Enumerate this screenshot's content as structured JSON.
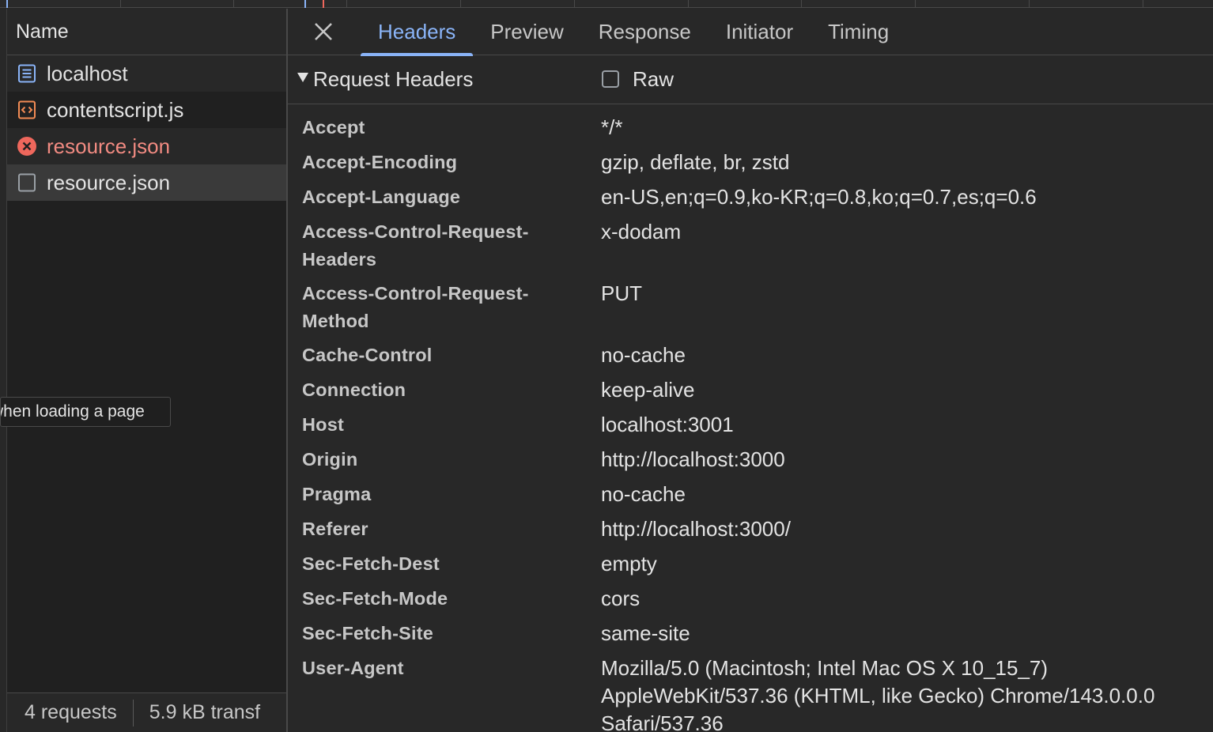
{
  "network_list": {
    "name_column_header": "Name",
    "requests": [
      {
        "label": "localhost",
        "icon": "document-icon",
        "state": "normal"
      },
      {
        "label": "contentscript.js",
        "icon": "script-icon",
        "state": "normal"
      },
      {
        "label": "resource.json",
        "icon": "error-icon",
        "state": "error"
      },
      {
        "label": "resource.json",
        "icon": "blank-file-icon",
        "state": "selected"
      }
    ],
    "status": {
      "requests_count": "4 requests",
      "transferred": "5.9 kB transf"
    },
    "tooltip": "when loading a page"
  },
  "details": {
    "tabs": [
      {
        "label": "Headers",
        "active": true
      },
      {
        "label": "Preview",
        "active": false
      },
      {
        "label": "Response",
        "active": false
      },
      {
        "label": "Initiator",
        "active": false
      },
      {
        "label": "Timing",
        "active": false
      }
    ],
    "request_headers": {
      "title": "Request Headers",
      "raw_label": "Raw",
      "raw_checked": false,
      "rows": [
        {
          "name": "Accept",
          "value": "*/*"
        },
        {
          "name": "Accept-Encoding",
          "value": "gzip, deflate, br, zstd"
        },
        {
          "name": "Accept-Language",
          "value": "en-US,en;q=0.9,ko-KR;q=0.8,ko;q=0.7,es;q=0.6"
        },
        {
          "name": "Access-Control-Request-Headers",
          "value": "x-dodam"
        },
        {
          "name": "Access-Control-Request-Method",
          "value": "PUT"
        },
        {
          "name": "Cache-Control",
          "value": "no-cache"
        },
        {
          "name": "Connection",
          "value": "keep-alive"
        },
        {
          "name": "Host",
          "value": "localhost:3001"
        },
        {
          "name": "Origin",
          "value": "http://localhost:3000"
        },
        {
          "name": "Pragma",
          "value": "no-cache"
        },
        {
          "name": "Referer",
          "value": "http://localhost:3000/"
        },
        {
          "name": "Sec-Fetch-Dest",
          "value": "empty"
        },
        {
          "name": "Sec-Fetch-Mode",
          "value": "cors"
        },
        {
          "name": "Sec-Fetch-Site",
          "value": "same-site"
        },
        {
          "name": "User-Agent",
          "value": "Mozilla/5.0 (Macintosh; Intel Mac OS X 10_15_7) AppleWebKit/537.36 (KHTML, like Gecko) Chrome/143.0.0.0 Safari/537.36"
        }
      ]
    }
  },
  "colors": {
    "accent": "#8ab4f8",
    "error": "#ee675c",
    "background": "#282828"
  }
}
